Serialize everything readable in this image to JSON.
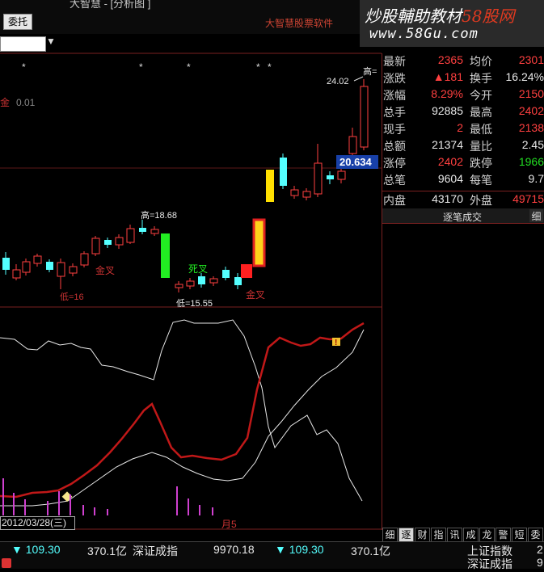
{
  "header": {
    "entrust_button": "委托",
    "title_fragment": "大智慧 - [分析图 ]",
    "logo_text": "大智慧股票软件",
    "dropdown_arrow": "▼",
    "watermark_line1_a": "炒股輔助教材",
    "watermark_line1_b": "58股网",
    "watermark_line2": "www.58Gu.com"
  },
  "price_chart": {
    "indicator_label": "金",
    "indicator_value": "0.01",
    "high_label": "高=18.68",
    "low_label": "低=16",
    "low2_label": "低=15.55",
    "recent_high_label": "高=",
    "recent_high_value": "24.02",
    "current_price_tag": "20.634",
    "golden_cross_1": "金叉",
    "dead_cross": "死叉",
    "golden_cross_2": "金叉",
    "star_marks": [
      "*",
      "*",
      "*",
      "*",
      "*"
    ]
  },
  "quote_panel": {
    "rows": [
      {
        "l1": "最新",
        "v1": "2365",
        "c1": "red",
        "l2": "均价",
        "v2": "2301",
        "c2": "red"
      },
      {
        "l1": "涨跌",
        "v1": "▲181",
        "c1": "red",
        "l2": "换手",
        "v2": "16.24%",
        "c2": "white"
      },
      {
        "l1": "涨幅",
        "v1": "8.29%",
        "c1": "red",
        "l2": "今开",
        "v2": "2150",
        "c2": "red"
      },
      {
        "l1": "总手",
        "v1": "92885",
        "c1": "white",
        "l2": "最高",
        "v2": "2402",
        "c2": "red"
      },
      {
        "l1": "现手",
        "v1": "2",
        "c1": "red",
        "l2": "最低",
        "v2": "2138",
        "c2": "red"
      },
      {
        "l1": "总额",
        "v1": "21374",
        "c1": "white",
        "l2": "量比",
        "v2": "2.45",
        "c2": "white"
      },
      {
        "l1": "涨停",
        "v1": "2402",
        "c1": "red",
        "l2": "跌停",
        "v2": "1966",
        "c2": "green"
      },
      {
        "l1": "总笔",
        "v1": "9604",
        "c1": "white",
        "l2": "每笔",
        "v2": "9.7",
        "c2": "white"
      },
      {
        "l1": "内盘",
        "v1": "43170",
        "c1": "white",
        "l2": "外盘",
        "v2": "49715",
        "c2": "red"
      }
    ],
    "subheader_label": "逐笔成交",
    "subheader_button": "细",
    "tabs": [
      "细",
      "逐",
      "财",
      "指",
      "讯",
      "成",
      "龙",
      "警",
      "短",
      "委"
    ],
    "active_tab": 1
  },
  "indicator_chart": {
    "signal_badge": "!"
  },
  "volume_chart": {
    "date_label": "2012/03/28(三)",
    "period_label": "月5"
  },
  "bottom_bar": {
    "val1": "▼ 109.30",
    "amt1": "370.1亿",
    "name1": "深证成指",
    "idx1": "9970.18",
    "val2": "▼ 109.30",
    "amt2": "370.1亿",
    "name_r1": "上证指数",
    "name_r2": "深证成指",
    "tail_r1": "2",
    "tail_r2": "9"
  },
  "colors": {
    "up": "#ff4040",
    "down": "#54ffff",
    "frame": "#7a2020",
    "ma_white": "#e8e8e8",
    "ma_red": "#c01818"
  }
}
